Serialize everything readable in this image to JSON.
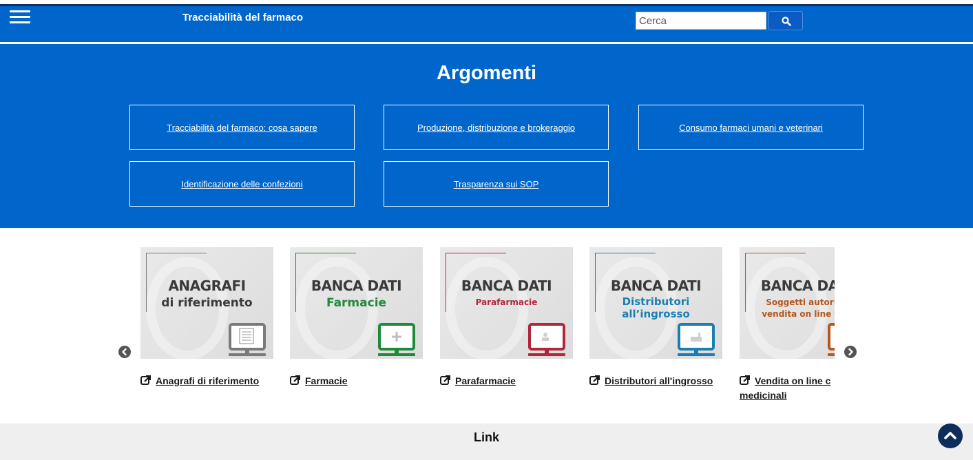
{
  "header": {
    "site_title": "Tracciabilità del farmaco",
    "search_placeholder": "Cerca",
    "menu_icon": "hamburger-icon",
    "search_icon": "search-icon"
  },
  "topics": {
    "title": "Argomenti",
    "items": [
      {
        "label": "Tracciabilità del farmaco: cosa sapere"
      },
      {
        "label": "Produzione, distribuzione e brokeraggio"
      },
      {
        "label": "Consumo farmaci umani e veterinari"
      },
      {
        "label": "Identificazione delle confezioni"
      },
      {
        "label": "Trasparenza sui SOP"
      }
    ]
  },
  "carousel": {
    "prev_icon": "chevron-left-icon",
    "next_icon": "chevron-right-icon",
    "cards": [
      {
        "title": "ANAGRAFI",
        "subtitle": "di riferimento",
        "accent": "#7a7a7a",
        "subtitle_color": "#3a3a3a",
        "link": "Anagrafi di riferimento",
        "link2": ""
      },
      {
        "title": "BANCA DATI",
        "subtitle": "Farmacie",
        "accent": "#1f8a3a",
        "subtitle_color": "#1f8a3a",
        "link": "Farmacie",
        "link2": ""
      },
      {
        "title": "BANCA DATI",
        "subtitle": "Parafarmacie",
        "accent": "#b0263a",
        "subtitle_color": "#b0263a",
        "link": "Parafarmacie",
        "link2": ""
      },
      {
        "title": "BANCA DATI",
        "subtitle": "Distributori",
        "subtitle2": "all’ingrosso",
        "accent": "#1a7fb0",
        "subtitle_color": "#1a7fb0",
        "link": "Distributori all'ingrosso",
        "link2": ""
      },
      {
        "title": "BANCA DATI",
        "subtitle": "Soggetti autorizz",
        "subtitle2": "vendita on line farı",
        "accent": "#b5561a",
        "subtitle_color": "#b5561a",
        "link": "Vendita on line c",
        "link2": "medicinali"
      }
    ]
  },
  "footer": {
    "link_title": "Link",
    "back_to_top_icon": "chevron-up-icon"
  },
  "colors": {
    "primary_blue": "#0066cc",
    "dark_navy": "#0d2d5a",
    "footer_bg": "#efefef"
  }
}
